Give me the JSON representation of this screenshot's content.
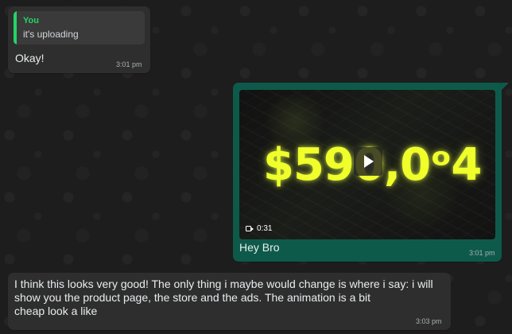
{
  "messages": [
    {
      "type": "incoming",
      "reply": {
        "author": "You",
        "text": "it's uploading"
      },
      "text": "Okay!",
      "time": "3:01 pm"
    },
    {
      "type": "outgoing",
      "video": {
        "overlay_text": "$590,0ᵒ4",
        "duration": "0:31"
      },
      "caption": "Hey Bro",
      "time": "3:01 pm"
    },
    {
      "type": "incoming",
      "lines": [
        "I think this looks very good! The only thing i maybe would change is where i say: i will",
        "show you the product page, the store and the ads. The animation is a bit",
        "cheap look a like"
      ],
      "time": "3:03 pm"
    }
  ],
  "theme": {
    "background": "#1d1d1d",
    "incoming_bubble": "#2e2e2e",
    "outgoing_bubble": "#0e5a4a",
    "quote_accent": "#25d366",
    "video_text": "#f0ff2a"
  },
  "icons": {
    "play": "play-icon",
    "video_camera": "video-camera-icon"
  }
}
